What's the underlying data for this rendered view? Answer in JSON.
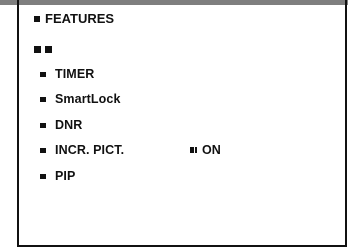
{
  "menu": {
    "title": "FEATURES",
    "items": [
      {
        "label": "TIMER"
      },
      {
        "label": "SmartLock"
      },
      {
        "label": "DNR"
      },
      {
        "label": "INCR. PICT.",
        "value": "ON"
      },
      {
        "label": "PIP"
      }
    ]
  }
}
